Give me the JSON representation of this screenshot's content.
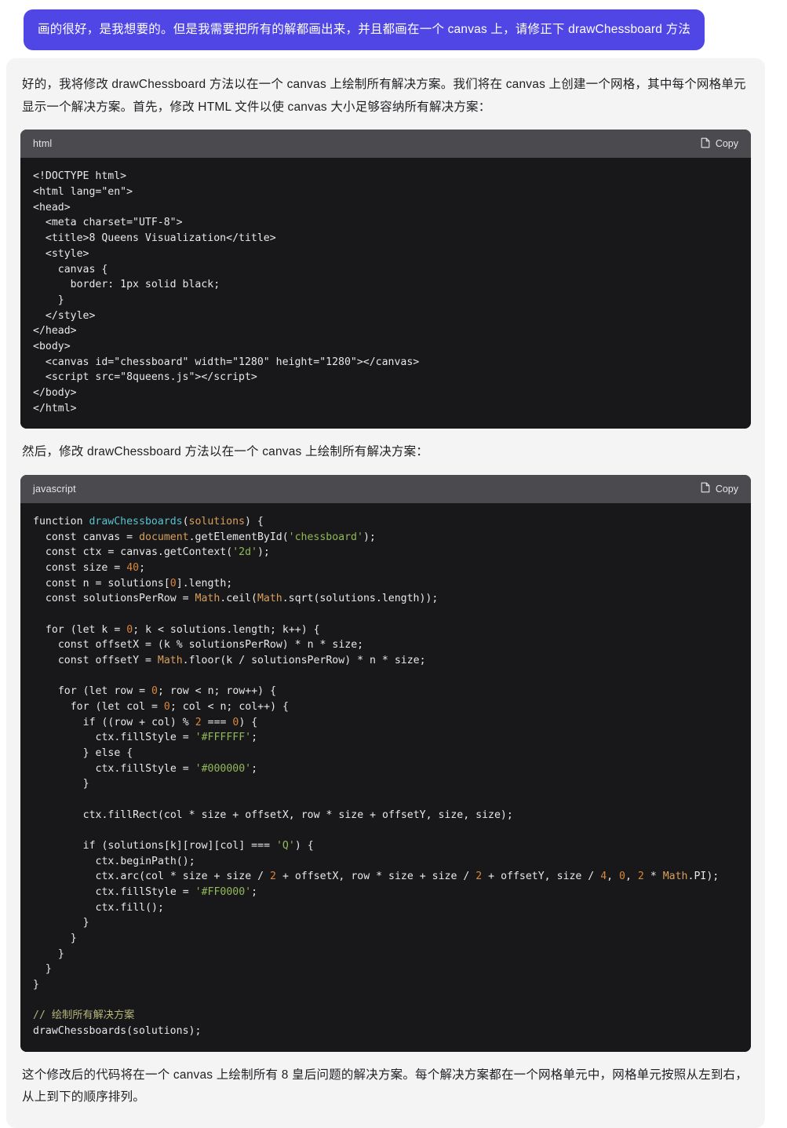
{
  "user_message": {
    "text": "画的很好，是我想要的。但是我需要把所有的解都画出来，并且都画在一个 canvas 上，请修正下 drawChessboard 方法",
    "bubble_color": "#4f46e5"
  },
  "assistant": {
    "intro_paragraph": "好的，我将修改 drawChessboard 方法以在一个 canvas 上绘制所有解决方案。我们将在 canvas 上创建一个网格，其中每个网格单元显示一个解决方案。首先，修改 HTML 文件以使 canvas 大小足够容纳所有解决方案：",
    "middle_paragraph": "然后，修改 drawChessboard 方法以在一个 canvas 上绘制所有解决方案：",
    "final_paragraph": "这个修改后的代码将在一个 canvas 上绘制所有 8 皇后问题的解决方案。每个解决方案都在一个网格单元中，网格单元按照从左到右，从上到下的顺序排列。",
    "code_blocks": [
      {
        "language": "html",
        "copy_label": "Copy",
        "copy_icon": "copy-page-icon",
        "code": "<!DOCTYPE html>\n<html lang=\"en\">\n<head>\n  <meta charset=\"UTF-8\">\n  <title>8 Queens Visualization</title>\n  <style>\n    canvas {\n      border: 1px solid black;\n    }\n  </style>\n</head>\n<body>\n  <canvas id=\"chessboard\" width=\"1280\" height=\"1280\"></canvas>\n  <script src=\"8queens.js\"></script>\n</body>\n</html>"
      },
      {
        "language": "javascript",
        "copy_label": "Copy",
        "copy_icon": "copy-page-icon",
        "code": "function drawChessboards(solutions) {\n  const canvas = document.getElementById('chessboard');\n  const ctx = canvas.getContext('2d');\n  const size = 40;\n  const n = solutions[0].length;\n  const solutionsPerRow = Math.ceil(Math.sqrt(solutions.length));\n\n  for (let k = 0; k < solutions.length; k++) {\n    const offsetX = (k % solutionsPerRow) * n * size;\n    const offsetY = Math.floor(k / solutionsPerRow) * n * size;\n\n    for (let row = 0; row < n; row++) {\n      for (let col = 0; col < n; col++) {\n        if ((row + col) % 2 === 0) {\n          ctx.fillStyle = '#FFFFFF';\n        } else {\n          ctx.fillStyle = '#000000';\n        }\n\n        ctx.fillRect(col * size + offsetX, row * size + offsetY, size, size);\n\n        if (solutions[k][row][col] === 'Q') {\n          ctx.beginPath();\n          ctx.arc(col * size + size / 2 + offsetX, row * size + size / 2 + offsetY, size / 4, 0, 2 * Math.PI);\n          ctx.fillStyle = '#FF0000';\n          ctx.fill();\n        }\n      }\n    }\n  }\n}\n\n// 绘制所有解决方案\ndrawChessboards(solutions);"
      }
    ]
  },
  "theme": {
    "page_background": "#ffffff",
    "assistant_card_background": "#f4f4f5",
    "code_header_background": "#4b4b4f",
    "code_body_background": "#18181a",
    "accent": "#4f46e5"
  }
}
